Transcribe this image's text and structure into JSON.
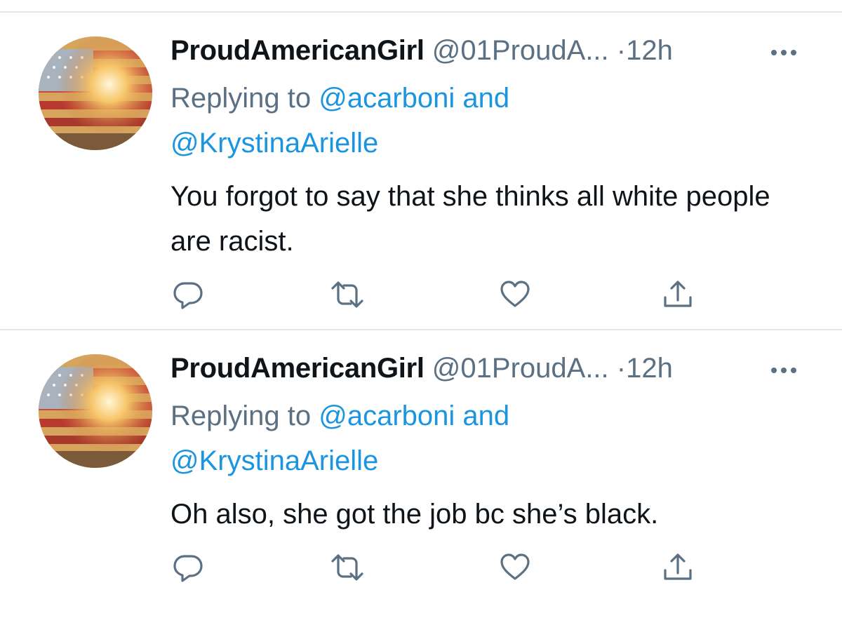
{
  "tweets": [
    {
      "display_name": "ProudAmericanGirl",
      "handle": "@01ProudA...",
      "dot": "·",
      "time": "12h",
      "replying_prefix": "Replying to",
      "mention_1": "@acarboni",
      "mention_joiner": "and",
      "mention_2": "@KrystinaArielle",
      "body": "You forgot to say that she thinks all white people are racist."
    },
    {
      "display_name": "ProudAmericanGirl",
      "handle": "@01ProudA...",
      "dot": "·",
      "time": "12h",
      "replying_prefix": "Replying to",
      "mention_1": "@acarboni",
      "mention_joiner": "and",
      "mention_2": "@KrystinaArielle",
      "body": "Oh also, she got the job bc she’s black."
    }
  ],
  "icons": {
    "more": "more-icon",
    "reply": "reply-icon",
    "retweet": "retweet-icon",
    "like": "like-icon",
    "share": "share-icon"
  },
  "colors": {
    "text": "#0f1419",
    "secondary": "#5b7083",
    "link": "#1b95e0",
    "divider": "#e1e8ed"
  }
}
